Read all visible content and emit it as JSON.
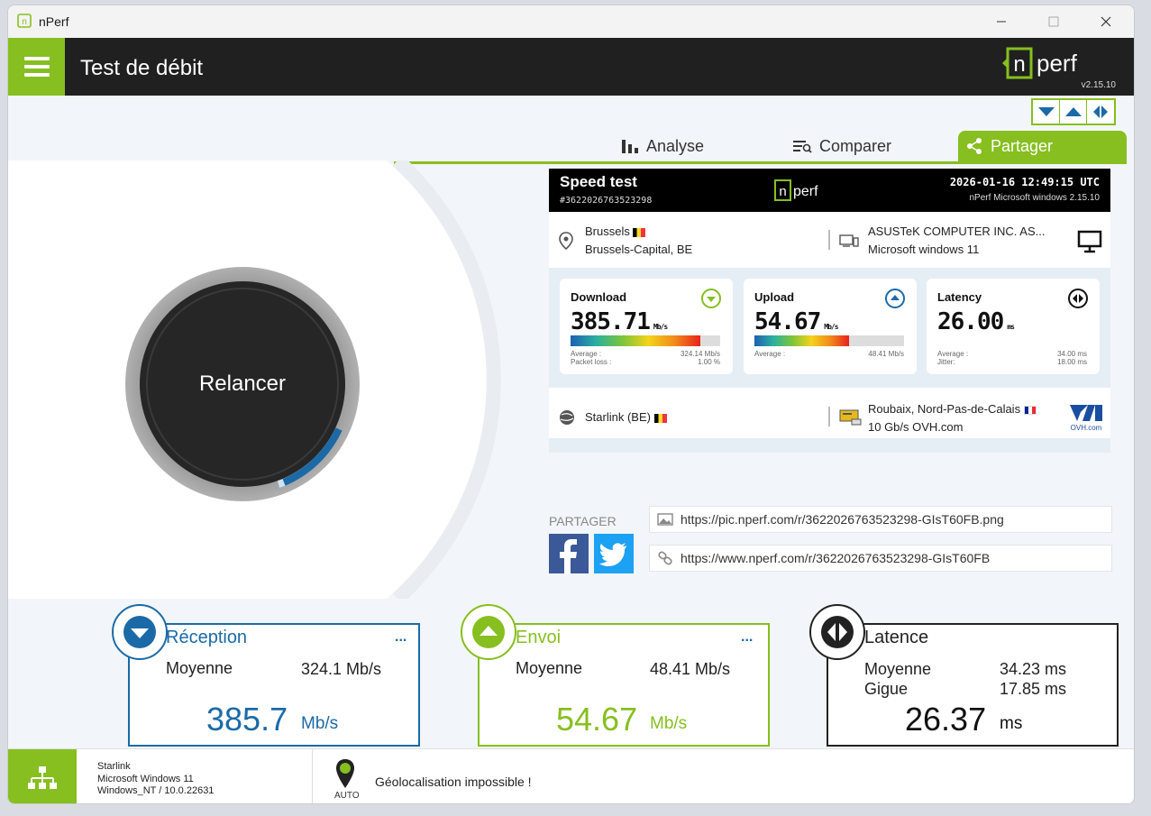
{
  "window": {
    "title": "nPerf"
  },
  "header": {
    "title": "Test de débit",
    "version": "v2.15.10"
  },
  "tabs": [
    {
      "label": "Analyse",
      "icon": "bar-chart-icon"
    },
    {
      "label": "Comparer",
      "icon": "compare-icon"
    },
    {
      "label": "Partager",
      "icon": "share-icon",
      "active": true
    }
  ],
  "dial": {
    "label": "Relancer"
  },
  "result": {
    "title": "Speed test",
    "id": "#3622026763523298",
    "date": "2026-01-16 12:49:15 UTC",
    "app": "nPerf Microsoft windows 2.15.10",
    "city": "Brussels",
    "region": "Brussels-Capital, BE",
    "device": "ASUSTeK COMPUTER INC. AS...",
    "os": "Microsoft windows 11",
    "download": {
      "name": "Download",
      "value": "385.71",
      "unit": "Mb/s",
      "avg_label": "Average :",
      "avg": "324.14 Mb/s",
      "loss_label": "Packet loss :",
      "loss": "1.00 %",
      "fill": 0.87
    },
    "upload": {
      "name": "Upload",
      "value": "54.67",
      "unit": "Mb/s",
      "avg_label": "Average :",
      "avg": "48.41 Mb/s",
      "fill": 0.63
    },
    "latency": {
      "name": "Latency",
      "value": "26.00",
      "unit": "ms",
      "avg_label": "Average :",
      "avg": "34.00 ms",
      "jitter_label": "Jitter:",
      "jitter": "18.00 ms"
    },
    "isp": "Starlink (BE)",
    "server_loc": "Roubaix, Nord-Pas-de-Calais",
    "server": "10 Gb/s OVH.com",
    "server_logo": "OVH.com"
  },
  "share": {
    "label": "PARTAGER",
    "image_url": "https://pic.nperf.com/r/3622026763523298-GIsT60FB.png",
    "page_url": "https://www.nperf.com/r/3622026763523298-GIsT60FB"
  },
  "stats": {
    "reception": {
      "title": "Réception",
      "avg_label": "Moyenne",
      "avg": "324.1 Mb/s",
      "value": "385.7",
      "unit": "Mb/s",
      "more": "..."
    },
    "envoi": {
      "title": "Envoi",
      "avg_label": "Moyenne",
      "avg": "48.41 Mb/s",
      "value": "54.67",
      "unit": "Mb/s",
      "more": "..."
    },
    "latence": {
      "title": "Latence",
      "avg_label": "Moyenne",
      "avg": "34.23 ms",
      "jitter_label": "Gigue",
      "jitter": "17.85 ms",
      "value": "26.37",
      "unit": "ms"
    }
  },
  "status": {
    "isp": "Starlink",
    "os": "Microsoft Windows 11",
    "kernel": "Windows_NT / 10.0.22631",
    "geo_mode": "AUTO",
    "geo_message": "Géolocalisation impossible !"
  },
  "colors": {
    "accent": "#86bf1f",
    "download": "#1b6aa7",
    "upload": "#86bf1f",
    "latency": "#222222"
  }
}
